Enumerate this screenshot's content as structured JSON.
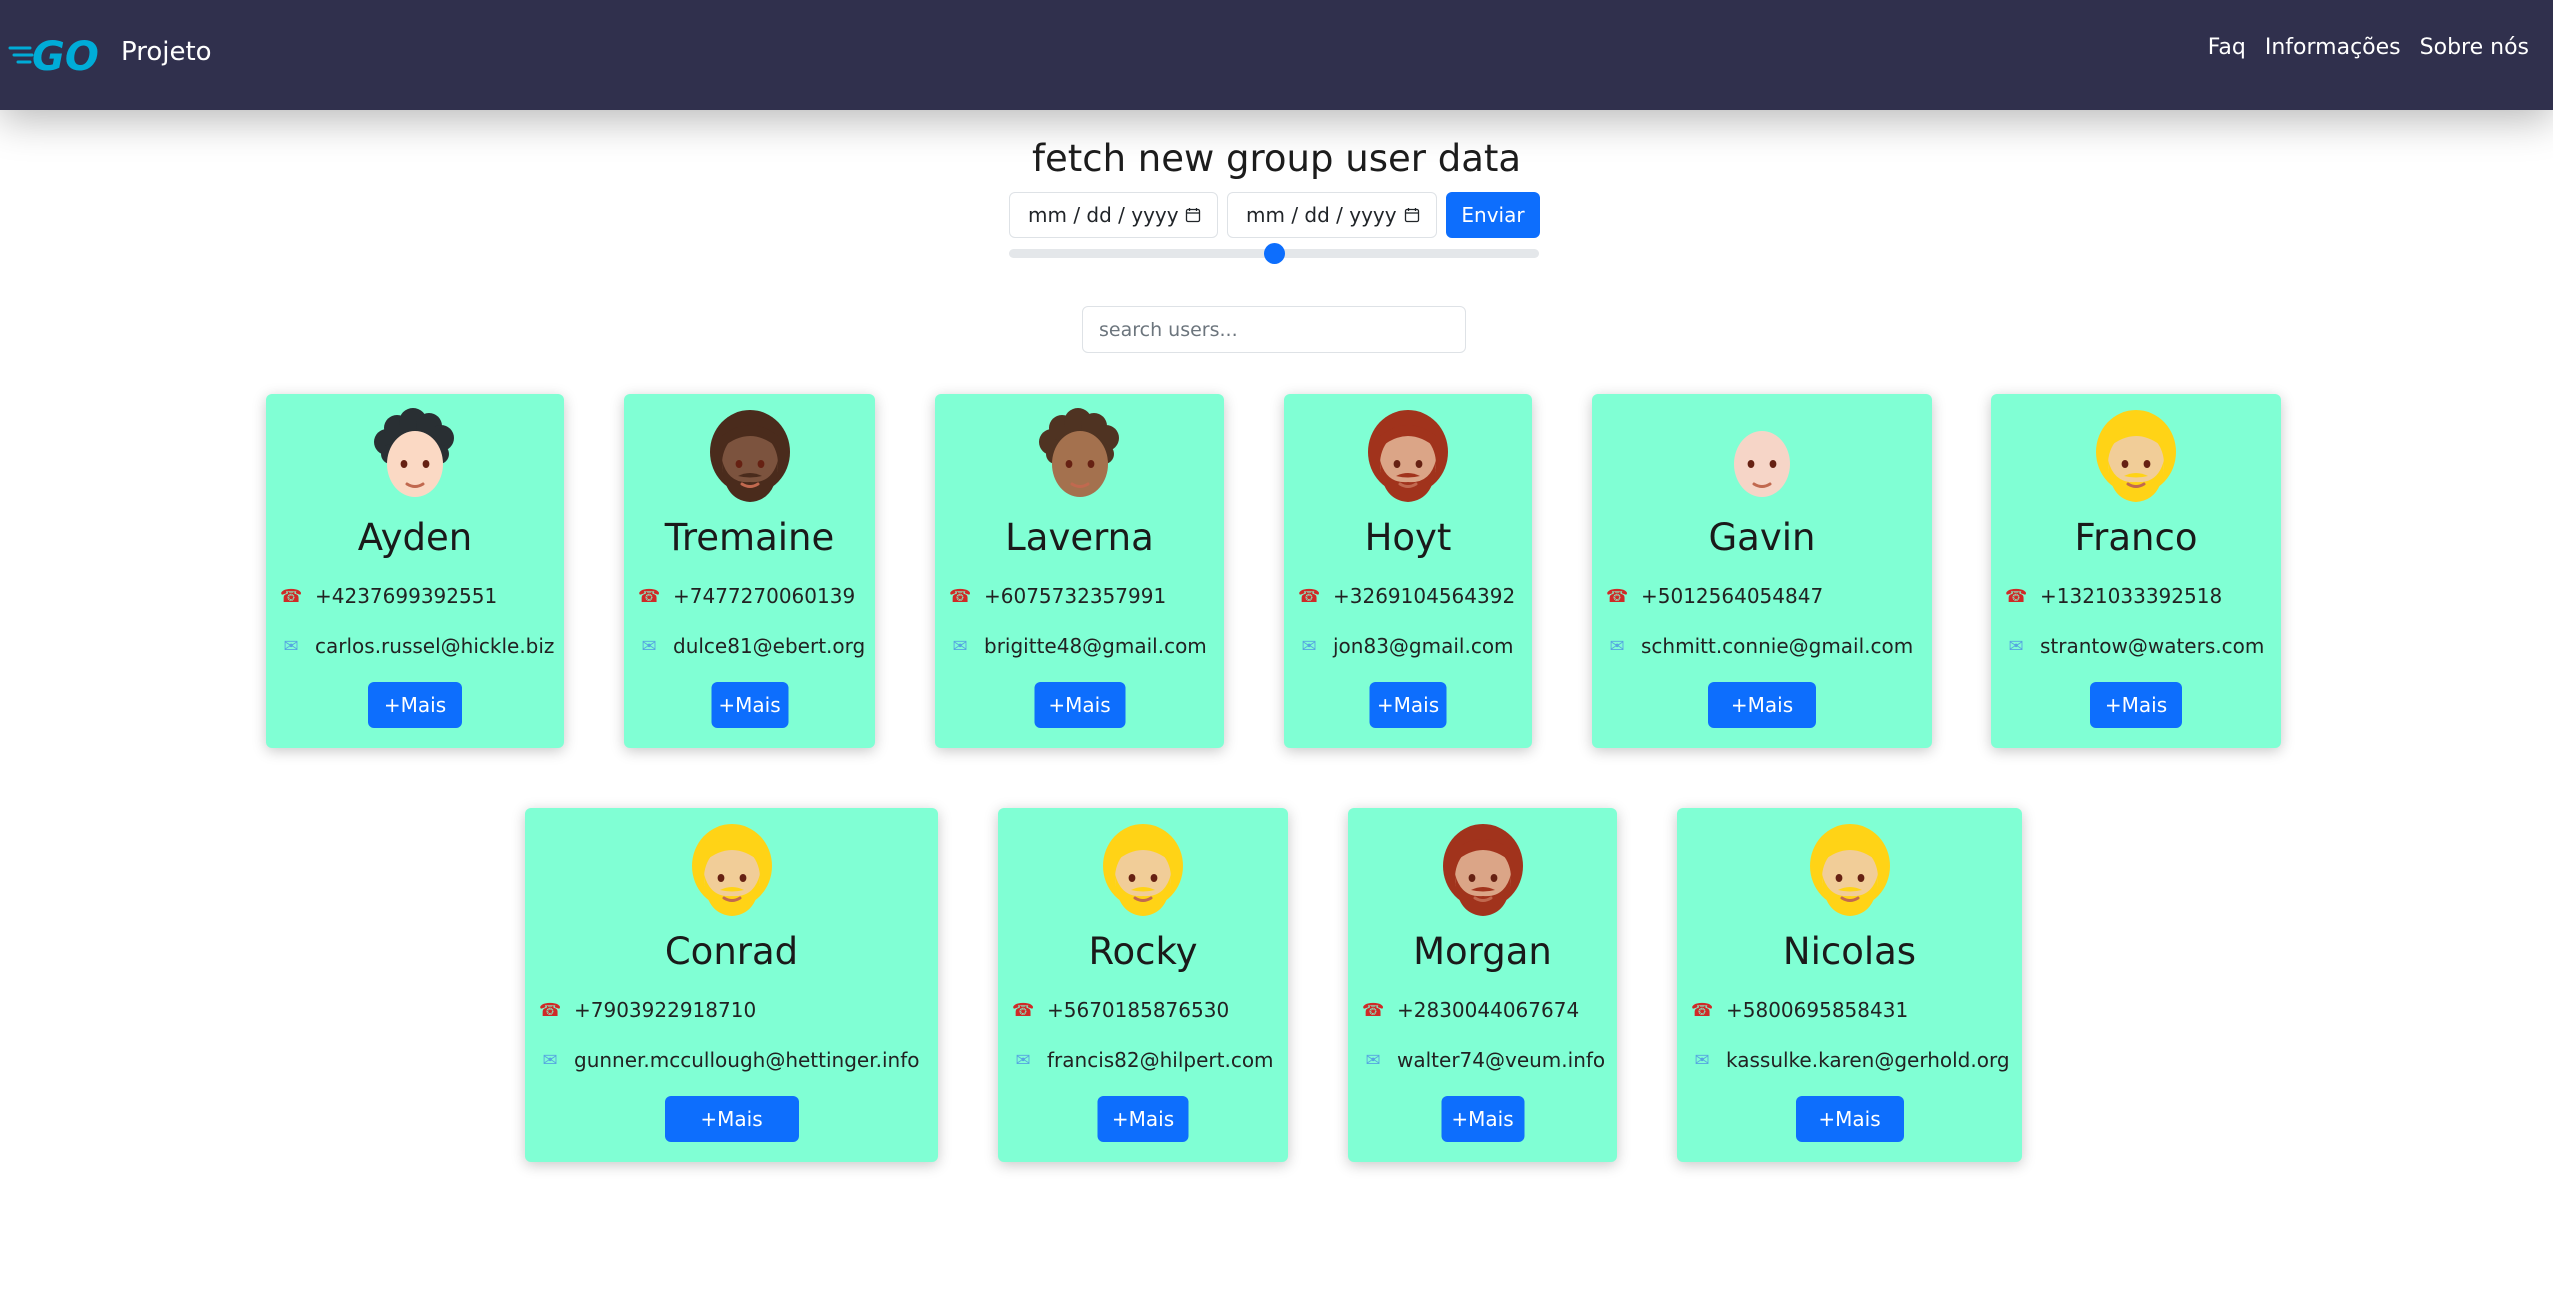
{
  "navbar": {
    "logo_text": "GO",
    "brand": "Projeto",
    "links": [
      "Faq",
      "Informações",
      "Sobre nós"
    ]
  },
  "fetch": {
    "title": "fetch new group user data",
    "date_placeholder": "mm / dd / yyyy",
    "submit_label": "Enviar",
    "slider_value": 0.5
  },
  "search": {
    "placeholder": "search users..."
  },
  "more_label": "+Mais",
  "users": [
    {
      "name": "Ayden",
      "phone": "+4237699392551",
      "email": "carlos.russel@hickle.biz",
      "avatar": "curly-dark-hair-light-skin"
    },
    {
      "name": "Tremaine",
      "phone": "+7477270060139",
      "email": "dulce81@ebert.org",
      "avatar": "bearded-dark-skin"
    },
    {
      "name": "Laverna",
      "phone": "+6075732357991",
      "email": "brigitte48@gmail.com",
      "avatar": "curly-hair-medium-dark-skin"
    },
    {
      "name": "Hoyt",
      "phone": "+3269104564392",
      "email": "jon83@gmail.com",
      "avatar": "bearded-red-hair"
    },
    {
      "name": "Gavin",
      "phone": "+5012564054847",
      "email": "schmitt.connie@gmail.com",
      "avatar": "bald-light-skin"
    },
    {
      "name": "Franco",
      "phone": "+1321033392518",
      "email": "strantow@waters.com",
      "avatar": "bearded-blond-hair"
    },
    {
      "name": "Conrad",
      "phone": "+7903922918710",
      "email": "gunner.mccullough@hettinger.info",
      "avatar": "bearded-blond-hair"
    },
    {
      "name": "Rocky",
      "phone": "+5670185876530",
      "email": "francis82@hilpert.com",
      "avatar": "bearded-blond-hair"
    },
    {
      "name": "Morgan",
      "phone": "+2830044067674",
      "email": "walter74@veum.info",
      "avatar": "bearded-red-hair"
    },
    {
      "name": "Nicolas",
      "phone": "+5800695858431",
      "email": "kassulke.karen@gerhold.org",
      "avatar": "bearded-blond-hair"
    }
  ]
}
